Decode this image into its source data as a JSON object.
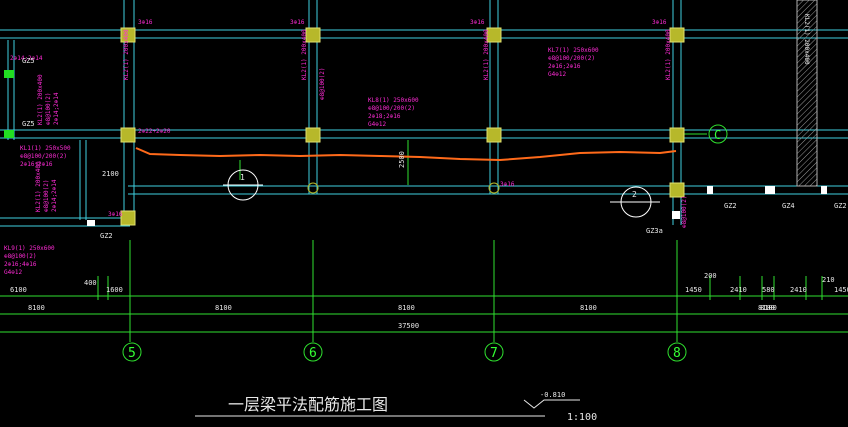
{
  "drawing": {
    "title": "一层梁平法配筋施工图",
    "scale": "1:100",
    "elevation": "-0.810"
  },
  "axes": {
    "grid_labels": [
      "5",
      "6",
      "7",
      "8"
    ],
    "row_label": "C"
  },
  "dimensions": {
    "spans": [
      "8100",
      "8100",
      "8100",
      "8100"
    ],
    "total": "37500",
    "left_segments": [
      "6100",
      "400",
      "1600"
    ],
    "right_segments": [
      "1450",
      "2410",
      "580",
      "2410",
      "1450"
    ],
    "right_total": "8100",
    "small": [
      "2100",
      "200",
      "210",
      "2100",
      "2500"
    ]
  },
  "annotations": {
    "gz_labels": [
      "GZ5",
      "GZ5",
      "GZ2",
      "GZ2",
      "GZ4",
      "GZ2",
      "GZ3a"
    ],
    "top_marks": [
      "3⊕16",
      "3⊕16",
      "3⊕16",
      "3⊕16"
    ],
    "beam_note_1": [
      "KL7(1) 250x600",
      "⊕8@100/200(2)",
      "2⊕16;2⊕16",
      "G4⊕12"
    ],
    "beam_note_2": [
      "KL8(1) 250x600",
      "⊕8@100/200(2)",
      "2⊕18;2⊕16",
      "G4⊕12"
    ],
    "beam_note_3": [
      "KL9(1) 250x600",
      "⊕8@100(2)",
      "2⊕16;4⊕16",
      "G4⊕12"
    ],
    "left_note": [
      "KL1(1) 250x500",
      "⊕8@100/200(2)",
      "2⊕16;2⊕16"
    ],
    "left_vert": [
      "KL2(1) 200x400",
      "⊕8@100(2)",
      "2⊕14;2⊕14"
    ],
    "col_marks": [
      "2⊕22+2⊕20",
      "3⊕16"
    ],
    "section_marks": [
      "1",
      "2"
    ]
  }
}
